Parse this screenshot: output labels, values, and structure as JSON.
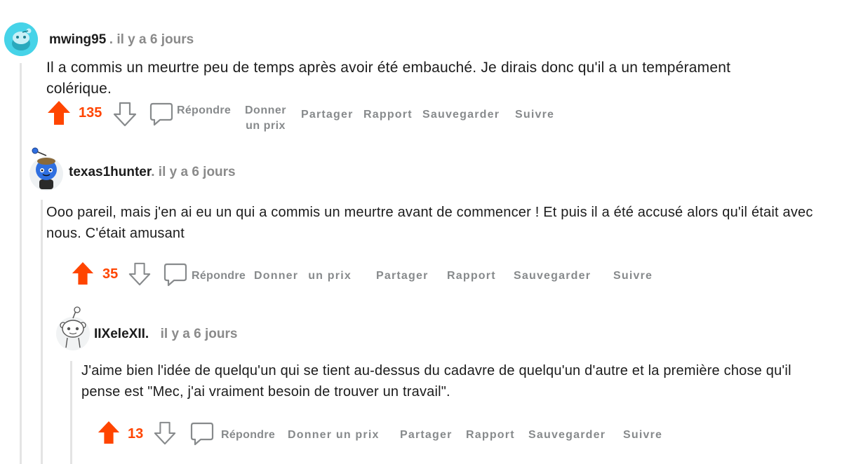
{
  "comments": [
    {
      "username": "mwing95",
      "meta": ". il y a 6 jours",
      "body": "Il a commis un meurtre peu de temps après avoir été embauché. Je dirais donc qu'il a un tempérament colérique.",
      "score": "135",
      "actions": {
        "reply": "Répondre",
        "award_line1": "Donner",
        "award_line2": "un prix",
        "share": "Partager",
        "report": "Rapport",
        "save": "Sauvegarder",
        "follow": "Suivre"
      }
    },
    {
      "username": "texas1hunter",
      "meta": ". il y a 6 jours",
      "body": "Ooo pareil, mais j'en ai eu un qui a commis un meurtre avant de commencer ! Et puis il a été accusé alors qu'il était avec nous. C'était amusant",
      "score": "35",
      "actions": {
        "reply": "Répondre",
        "award_line1": "Donner",
        "award_line2": "un prix",
        "share": "Partager",
        "report": "Rapport",
        "save": "Sauvegarder",
        "follow": "Suivre"
      }
    },
    {
      "username": "IIXeleXII.",
      "meta": "il y a 6 jours",
      "body": "J'aime bien l'idée de quelqu'un qui se tient au-dessus du cadavre de quelqu'un d'autre et la première chose qu'il pense est \"Mec, j'ai vraiment besoin de trouver un travail\".",
      "score": "13",
      "actions": {
        "reply": "Répondre",
        "award": "Donner un prix",
        "share": "Partager",
        "report": "Rapport",
        "save": "Sauvegarder",
        "follow": "Suivre"
      }
    }
  ],
  "colors": {
    "upvote": "#ff4500",
    "action_gray": "#878a8c",
    "thread_line": "#e4e4e4",
    "avatar_teal": "#46d3e8",
    "snoo_blue": "#2f6fe0"
  },
  "icons": [
    "upvote-arrow-icon",
    "downvote-arrow-icon",
    "comment-bubble-icon",
    "snoo-avatar-icon"
  ]
}
